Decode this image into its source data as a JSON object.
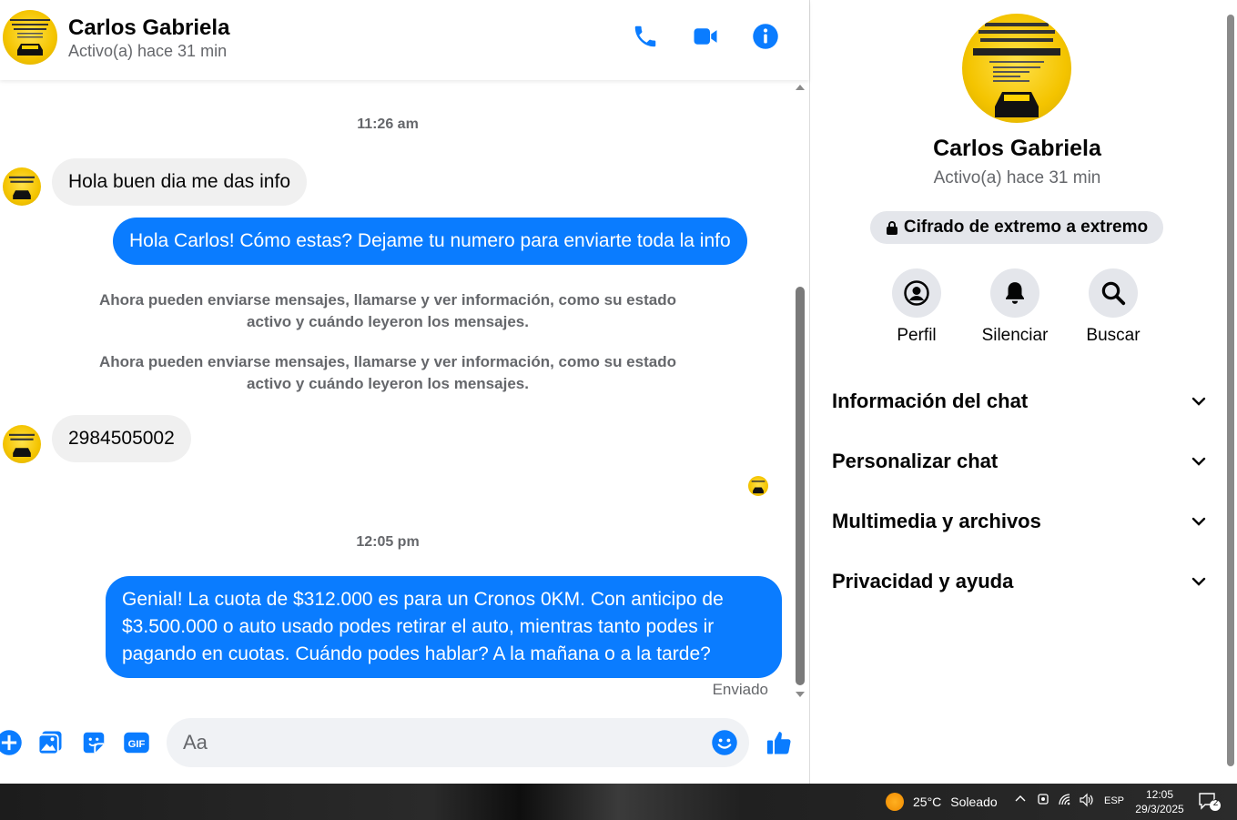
{
  "contact": {
    "name": "Carlos Gabriela",
    "status": "Activo(a) hace 31 min"
  },
  "header_icons": [
    "phone-icon",
    "video-icon",
    "info-icon"
  ],
  "messages": {
    "time_1": "11:26 am",
    "incoming_1": "Hola buen dia me das info",
    "outgoing_1": "Hola Carlos! Cómo estas? Dejame tu numero para enviarte toda la info",
    "system_1": "Ahora pueden enviarse mensajes, llamarse y ver información, como su estado activo y cuándo leyeron los mensajes.",
    "system_2": "Ahora pueden enviarse mensajes, llamarse y ver información, como su estado activo y cuándo leyeron los mensajes.",
    "incoming_2": "2984505002",
    "time_2": "12:05 pm",
    "outgoing_2": "Genial! La cuota de $312.000 es para un Cronos 0KM. Con anticipo de $3.500.000 o auto usado podes retirar el auto, mientras tanto podes ir pagando en cuotas. Cuándo podes hablar? A la mañana o a la tarde?",
    "sent_status": "Enviado"
  },
  "composer": {
    "placeholder": "Aa",
    "icons": [
      "plus-icon",
      "image-icon",
      "sticker-icon",
      "gif-icon",
      "emoji-icon",
      "like-icon"
    ]
  },
  "panel": {
    "name": "Carlos Gabriela",
    "status": "Activo(a) hace 31 min",
    "encryption": "Cifrado de extremo a extremo",
    "actions": [
      {
        "label": "Perfil",
        "icon": "profile-icon"
      },
      {
        "label": "Silenciar",
        "icon": "bell-icon"
      },
      {
        "label": "Buscar",
        "icon": "search-icon"
      }
    ],
    "sections": [
      "Información del chat",
      "Personalizar chat",
      "Multimedia y archivos",
      "Privacidad y ayuda"
    ]
  },
  "taskbar": {
    "temperature": "25°C",
    "weather": "Soleado",
    "language": "ESP",
    "time": "12:05",
    "date": "29/3/2025",
    "notifications": "2"
  },
  "colors": {
    "accent": "#0a7cff",
    "incoming_bubble": "#f0f0f0",
    "secondary_text": "#65676b"
  }
}
